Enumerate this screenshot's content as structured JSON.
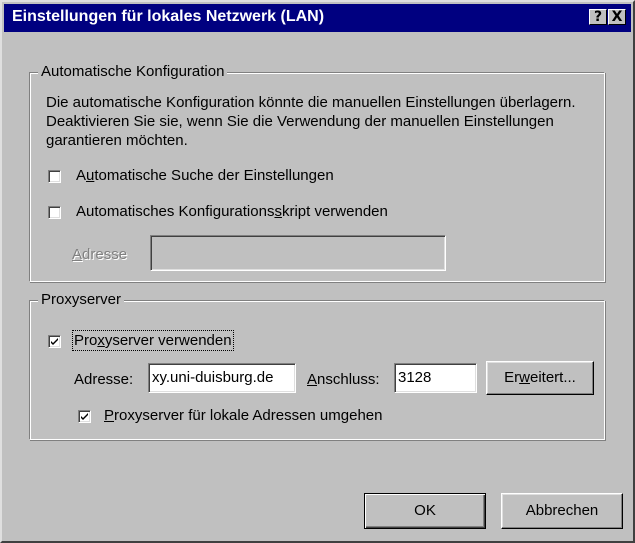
{
  "window": {
    "title": "Einstellungen für lokales Netzwerk (LAN)",
    "help_button": "?",
    "close_button": "X"
  },
  "auto_config": {
    "legend": "Automatische Konfiguration",
    "description": "Die automatische Konfiguration könnte die manuellen Einstellungen überlagern. Deaktivieren Sie sie, wenn Sie die Verwendung der manuellen Einstellungen garantieren möchten.",
    "auto_detect": {
      "label_pre": "A",
      "label_u": "u",
      "label_post": "tomatische Suche der Einstellungen",
      "checked": false
    },
    "auto_script": {
      "label_pre": "Automatisches Konfigurations",
      "label_u": "s",
      "label_post": "kript verwenden",
      "checked": false
    },
    "address": {
      "label_pre": "",
      "label_u": "A",
      "label_post": "dresse",
      "value": ""
    }
  },
  "proxy": {
    "legend": "Proxyserver",
    "use_proxy": {
      "label_pre": "Pro",
      "label_u": "x",
      "label_post": "yserver verwenden",
      "checked": true
    },
    "address_label": "Adresse:",
    "address_value": "xy.uni-duisburg.de",
    "port": {
      "label_pre": "",
      "label_u": "A",
      "label_post": "nschluss:",
      "value": "3128"
    },
    "advanced_button": {
      "label_pre": "Er",
      "label_u": "w",
      "label_post": "eitert..."
    },
    "bypass_local": {
      "label_pre": "",
      "label_u": "P",
      "label_post": "roxyserver für lokale Adressen umgehen",
      "checked": true
    }
  },
  "buttons": {
    "ok": "OK",
    "cancel": "Abbrechen"
  }
}
